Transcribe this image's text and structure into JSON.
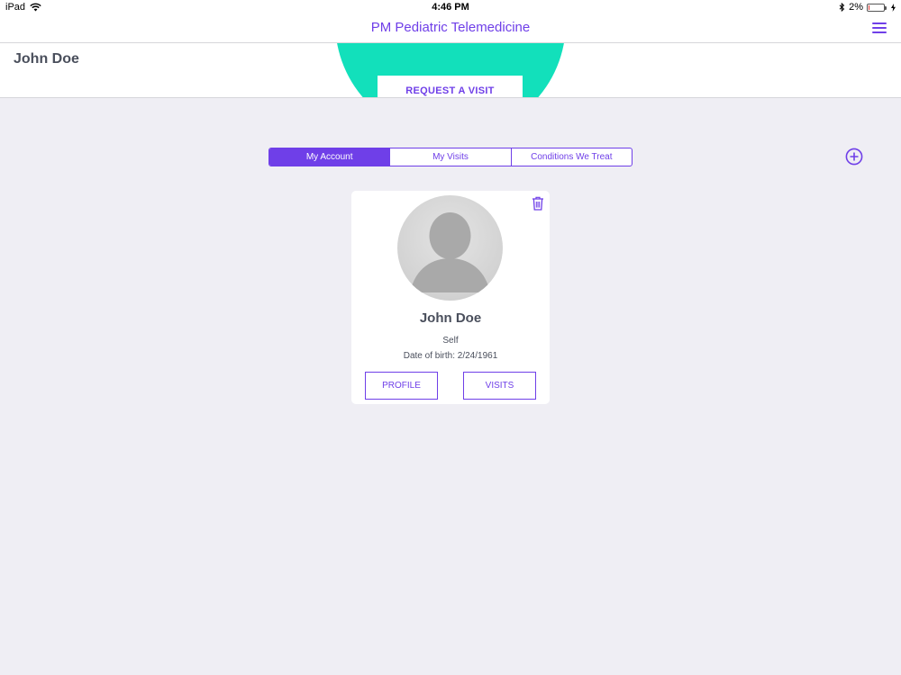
{
  "status_bar": {
    "device": "iPad",
    "time": "4:46 PM",
    "battery_percent": "2%",
    "icons": [
      "wifi-icon",
      "bluetooth-icon",
      "battery-icon",
      "charging-icon"
    ]
  },
  "nav": {
    "title": "PM Pediatric Telemedicine",
    "menu_icon": "hamburger-menu-icon"
  },
  "header": {
    "user_name": "John Doe",
    "request_button": "REQUEST A VISIT"
  },
  "tabs": [
    {
      "label": "My Account",
      "active": true
    },
    {
      "label": "My Visits",
      "active": false
    },
    {
      "label": "Conditions We Treat",
      "active": false
    }
  ],
  "add_icon": "plus-circle-icon",
  "card": {
    "name": "John Doe",
    "relation": "Self",
    "dob": "Date of birth: 2/24/1961",
    "profile_button": "PROFILE",
    "visits_button": "VISITS",
    "delete_icon": "trash-icon",
    "avatar_icon": "person-placeholder-icon"
  },
  "colors": {
    "accent": "#6f3fe8",
    "hero": "#12e0bb",
    "background": "#efeef4",
    "text": "#4a4f5c"
  }
}
